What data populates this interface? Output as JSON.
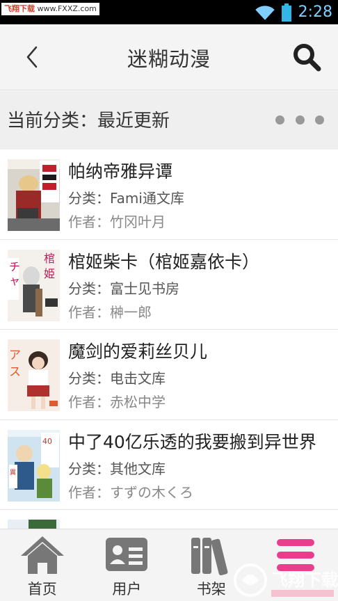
{
  "status_bar": {
    "watermark_left": "飞翔下载",
    "watermark_right": "www.FXXZ.com",
    "time": "2:28"
  },
  "header": {
    "title": "迷糊动漫",
    "back_icon": "chevron-left-icon",
    "search_icon": "search-icon"
  },
  "category": {
    "label": "当前分类：最近更新",
    "more_icon": "more-dots-icon"
  },
  "books": [
    {
      "title": "帕纳帝雅异谭",
      "category": "分类：Fami通文库",
      "author": "作者：竹冈叶月"
    },
    {
      "title": "棺姬柴卡（棺姬嘉依卡）",
      "category": "分类：富士见书房",
      "author": "作者：榊一郎"
    },
    {
      "title": "魔剑的爱莉丝贝儿",
      "category": "分类：电击文库",
      "author": "作者：赤松中学"
    },
    {
      "title": "中了40亿乐透的我要搬到异世界",
      "category": "分类：其他文库",
      "author": "作者：すずの木くろ"
    }
  ],
  "nav": [
    {
      "label": "首页",
      "icon": "home-icon"
    },
    {
      "label": "用户",
      "icon": "user-card-icon"
    },
    {
      "label": "书架",
      "icon": "bookshelf-icon"
    },
    {
      "label": "",
      "icon": "menu-icon"
    }
  ],
  "bottom_watermark": "飞翔下载",
  "colors": {
    "accent_pink": "#e83e8c",
    "clock_blue": "#7fd0ff",
    "battery_blue": "#33b5e5"
  }
}
